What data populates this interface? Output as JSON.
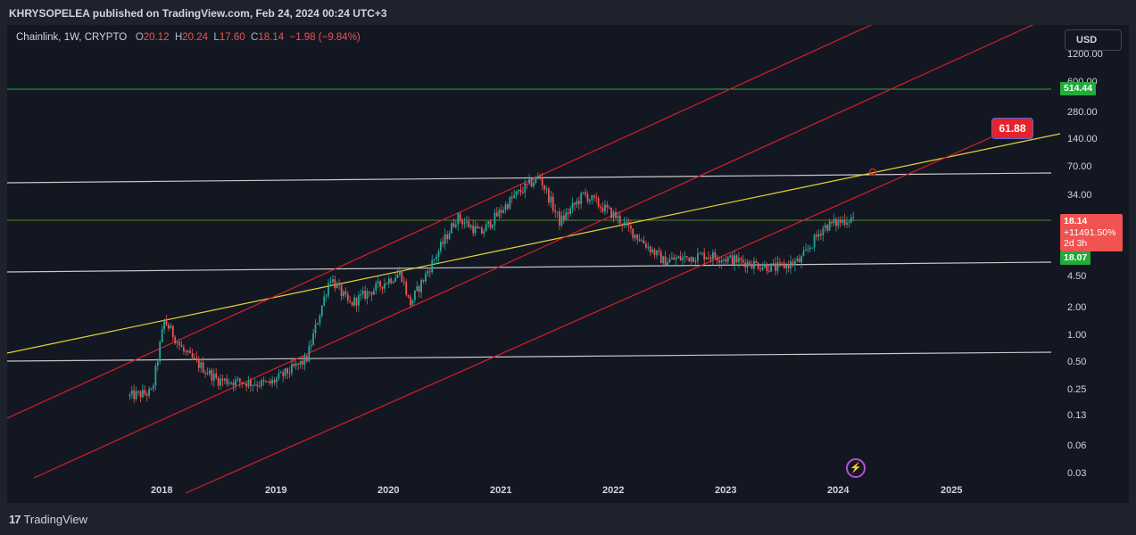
{
  "header": {
    "text": "KHRYSOPELEA published on TradingView.com, Feb 24, 2024 00:24 UTC+3"
  },
  "legend": {
    "symbol": "Chainlink, 1W, CRYPTO",
    "o_label": "O",
    "o": "20.12",
    "h_label": "H",
    "h": "20.24",
    "l_label": "L",
    "l": "17.60",
    "c_label": "C",
    "c": "18.14",
    "change": "−1.98 (−9.84%)"
  },
  "currency_button": "USD",
  "price_axis": [
    "1200.00",
    "600.00",
    "280.00",
    "140.00",
    "70.00",
    "34.00",
    "4.50",
    "2.00",
    "1.00",
    "0.50",
    "0.25",
    "0.13",
    "0.06",
    "0.03"
  ],
  "time_axis": [
    "2018",
    "2019",
    "2020",
    "2021",
    "2022",
    "2023",
    "2024",
    "2025"
  ],
  "badges": {
    "top_level": "514.44",
    "support_level": "18.07",
    "current_price": "18.14",
    "current_change": "+11491.50%",
    "countdown": "2d 3h",
    "target": "61.88"
  },
  "footer": {
    "logo_mark": "17",
    "brand": "TradingView"
  },
  "colors": {
    "background": "#131722",
    "up": "#26a69a",
    "down": "#ef5350",
    "channel": "#d81e28",
    "trend": "#e6d33a",
    "horizontal": "#c8c8c8",
    "level": "#22ab3a"
  },
  "chart_data": {
    "type": "candlestick",
    "symbol": "Chainlink",
    "interval": "1W",
    "exchange": "CRYPTO",
    "y_scale": "log",
    "currency": "USD",
    "ohlc_last": {
      "open": 20.12,
      "high": 20.24,
      "low": 17.6,
      "close": 18.14,
      "change": -1.98,
      "change_pct": -9.84
    },
    "price_path": [
      {
        "date": "2017-09-20",
        "price": 0.2
      },
      {
        "date": "2017-12-01",
        "price": 0.22
      },
      {
        "date": "2018-01-10",
        "price": 1.35
      },
      {
        "date": "2018-03-15",
        "price": 0.6
      },
      {
        "date": "2018-07-01",
        "price": 0.3
      },
      {
        "date": "2018-12-15",
        "price": 0.27
      },
      {
        "date": "2019-04-15",
        "price": 0.5
      },
      {
        "date": "2019-07-01",
        "price": 4.0
      },
      {
        "date": "2019-09-01",
        "price": 2.0
      },
      {
        "date": "2020-02-15",
        "price": 4.5
      },
      {
        "date": "2020-03-15",
        "price": 2.0
      },
      {
        "date": "2020-08-15",
        "price": 18.0
      },
      {
        "date": "2020-11-01",
        "price": 12.0
      },
      {
        "date": "2021-02-15",
        "price": 30.0
      },
      {
        "date": "2021-05-10",
        "price": 50.0
      },
      {
        "date": "2021-07-15",
        "price": 16.0
      },
      {
        "date": "2021-10-01",
        "price": 32.0
      },
      {
        "date": "2022-01-15",
        "price": 18.0
      },
      {
        "date": "2022-06-15",
        "price": 6.0
      },
      {
        "date": "2022-11-01",
        "price": 7.0
      },
      {
        "date": "2023-06-15",
        "price": 5.0
      },
      {
        "date": "2023-09-01",
        "price": 6.0
      },
      {
        "date": "2023-11-15",
        "price": 14.0
      },
      {
        "date": "2024-02-24",
        "price": 18.14
      }
    ],
    "levels": [
      {
        "kind": "horizontal",
        "price": 514.44
      },
      {
        "kind": "horizontal",
        "price": 18.07
      }
    ],
    "annotations": [
      {
        "kind": "price_label",
        "price": 61.88,
        "date": "2024-04-15"
      }
    ]
  }
}
